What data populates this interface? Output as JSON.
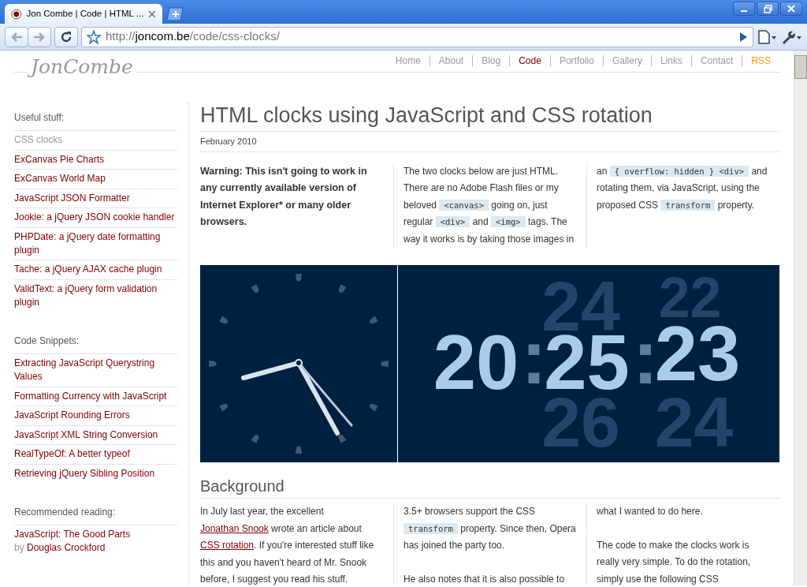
{
  "browser": {
    "tab": {
      "title": "Jon Combe | Code | HTML ..."
    },
    "address": {
      "scheme": "http://",
      "host": "joncom.be",
      "path": "/code/css-clocks/"
    }
  },
  "site": {
    "logo": "JonCombe",
    "nav": [
      {
        "label": "Home",
        "selected": false,
        "kind": "page"
      },
      {
        "label": "About",
        "selected": false,
        "kind": "page"
      },
      {
        "label": "Blog",
        "selected": false,
        "kind": "page"
      },
      {
        "label": "Code",
        "selected": true,
        "kind": "page"
      },
      {
        "label": "Portfolio",
        "selected": false,
        "kind": "page"
      },
      {
        "label": "Gallery",
        "selected": false,
        "kind": "page"
      },
      {
        "label": "Links",
        "selected": false,
        "kind": "page"
      },
      {
        "label": "Contact",
        "selected": false,
        "kind": "page"
      },
      {
        "label": "RSS",
        "selected": false,
        "kind": "feed"
      }
    ]
  },
  "sidebar": {
    "sections": [
      {
        "title": "Useful stuff:",
        "items": [
          {
            "label": "CSS clocks",
            "selected": true
          },
          {
            "label": "ExCanvas Pie Charts",
            "selected": false
          },
          {
            "label": "ExCanvas World Map",
            "selected": false
          },
          {
            "label": "JavaScript JSON Formatter",
            "selected": false
          },
          {
            "label": "Jookie: a jQuery JSON cookie handler",
            "selected": false
          },
          {
            "label": "PHPDate: a jQuery date formatting plugin",
            "selected": false
          },
          {
            "label": "Tache: a jQuery AJAX cache plugin",
            "selected": false
          },
          {
            "label": "ValidText: a jQuery form validation plugin",
            "selected": false
          }
        ]
      },
      {
        "title": "Code Snippets:",
        "items": [
          {
            "label": "Extracting JavaScript Querystring Values",
            "selected": false
          },
          {
            "label": "Formatting Currency with JavaScript",
            "selected": false
          },
          {
            "label": "JavaScript Rounding Errors",
            "selected": false
          },
          {
            "label": "JavaScript XML String Conversion",
            "selected": false
          },
          {
            "label": "RealTypeOf: A better typeof",
            "selected": false
          },
          {
            "label": "Retrieving jQuery Sibling Position",
            "selected": false
          }
        ]
      },
      {
        "title": "Recommended reading:",
        "items": [
          {
            "label": "JavaScript: The Good Parts",
            "selected": false,
            "by": "by",
            "author": "Douglas Crockford"
          }
        ]
      }
    ]
  },
  "article": {
    "title": "HTML clocks using JavaScript and CSS rotation",
    "date": "February 2010",
    "intro_columns": [
      [
        {
          "strong": true,
          "segments": [
            {
              "kind": "text",
              "text": "Warning: This isn't going to work in any currently available version of Internet Explorer* or many older browsers."
            }
          ]
        }
      ],
      [
        {
          "strong": false,
          "segments": [
            {
              "kind": "text",
              "text": "The two clocks below are just HTML. There are no Adobe Flash files or my beloved "
            },
            {
              "kind": "code",
              "text": "<canvas>"
            },
            {
              "kind": "text",
              "text": " going on, just regular "
            },
            {
              "kind": "code",
              "text": "<div>"
            },
            {
              "kind": "text",
              "text": " and "
            },
            {
              "kind": "code",
              "text": "<img>"
            },
            {
              "kind": "text",
              "text": " tags. The way it works is by taking those images in"
            }
          ]
        }
      ],
      [
        {
          "strong": false,
          "segments": [
            {
              "kind": "text",
              "text": "an "
            },
            {
              "kind": "code",
              "text": "{ overflow: hidden } <div>"
            },
            {
              "kind": "text",
              "text": " and rotating them, via JavaScript, using the proposed CSS "
            },
            {
              "kind": "code",
              "text": "transform"
            },
            {
              "kind": "text",
              "text": " property."
            }
          ]
        }
      ]
    ],
    "digital_clock": {
      "hours": "20",
      "minutes": "25",
      "seconds": "23",
      "separators": [
        ":",
        ":"
      ],
      "above": [
        "24",
        "22"
      ],
      "below": [
        "26",
        "24"
      ]
    },
    "sections": [
      {
        "heading": "Background",
        "columns": [
          [
            {
              "strong": false,
              "segments": [
                {
                  "kind": "text",
                  "text": "In July last year, the excellent "
                },
                {
                  "kind": "link",
                  "text": "Jonathan Snook"
                },
                {
                  "kind": "text",
                  "text": " wrote an article about "
                },
                {
                  "kind": "link",
                  "text": "CSS rotation"
                },
                {
                  "kind": "text",
                  "text": ". If you're interested stuff like this and you haven't heard of Mr. Snook before, I suggest you read his stuff."
                }
              ]
            }
          ],
          [
            {
              "strong": false,
              "segments": [
                {
                  "kind": "text",
                  "text": "3.5+ browsers support the CSS "
                },
                {
                  "kind": "code",
                  "text": "transform"
                },
                {
                  "kind": "text",
                  "text": " property. Since then, Opera has joined the party too."
                }
              ]
            },
            {
              "strong": false,
              "segments": [
                {
                  "kind": "text",
                  "text": "He also notes that it is also possible to"
                }
              ]
            }
          ],
          [
            {
              "strong": false,
              "segments": [
                {
                  "kind": "text",
                  "text": "what I wanted to do here."
                }
              ]
            },
            {
              "strong": false,
              "segments": [
                {
                  "kind": "text",
                  "text": "The code to make the clocks work is really very simple. To do the rotation, simply use the following CSS"
                }
              ]
            }
          ]
        ]
      }
    ]
  }
}
